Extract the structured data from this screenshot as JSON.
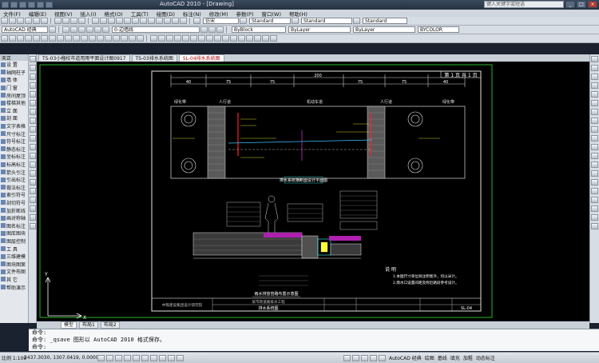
{
  "window": {
    "title": "AutoCAD 2010 - [Drawing]",
    "search_placeholder": "键入关键字或短语"
  },
  "menu": {
    "items": [
      "文件(F)",
      "编辑(E)",
      "视图(V)",
      "插入(I)",
      "格式(O)",
      "工具(T)",
      "绘图(D)",
      "标注(N)",
      "修改(M)",
      "参数(P)",
      "窗口(W)",
      "帮助(H)"
    ]
  },
  "toolbar": {
    "workspace": "AutoCAD 经典",
    "text_style": "Standard",
    "dim_style": "Standard",
    "table_style": "Standard",
    "font": "仿宋",
    "layer": "0-边墙线",
    "color": "ByBlock",
    "linetype": "ByLayer",
    "lineweight": "ByLayer",
    "plot_style": "BYCOLOR"
  },
  "left_panel": {
    "header": "天正",
    "items": [
      "设 置",
      "轴网柱子",
      "墙 体",
      "门 窗",
      "房间屋顶",
      "楼梯其他",
      "立 面",
      "剖 面",
      "文字表格",
      "尺寸标注",
      "符号标注",
      "静态标注",
      "坐标标注",
      "标高标注",
      "箭头引注",
      "引出标注",
      "做法标注",
      "索引符号",
      "剖切符号",
      "加折断线",
      "画对称轴",
      "图名标注",
      "图库图块",
      "图层控制",
      "工 具",
      "三维建模",
      "图块图案",
      "文件布图",
      "其 它",
      "帮助演示"
    ]
  },
  "doc_tabs": [
    "TS-03小榴校市道用雨平面设计图0917",
    "TS-03排水系统图",
    "SL-04排水系统图"
  ],
  "drawing": {
    "title": "排水系统图",
    "section_title": "排水系统横断面设计平面图",
    "detail_title": "雨水排放管路布置示意图",
    "total_width": "200",
    "segments": [
      "40",
      "75",
      "75",
      "75",
      "75",
      "40"
    ],
    "lane_labels": [
      "绿化带",
      "人行道",
      "机动车道",
      "人行道",
      "绿化带"
    ],
    "notes_title": "说 明",
    "notes": [
      "1.本图尺寸单位除注明者外，均以米计。",
      "2.雨水口设置间距及附近路段参考设计。",
      "3.施工时请严格按照相关规范施工。"
    ],
    "title_block": {
      "company": "中铁建设集团设计研究院",
      "project": "某市政道路排水工程",
      "drawing_name": "排水系统图",
      "sheet": "SL-04",
      "page": "第 1 页 共 1 页"
    }
  },
  "layout_tabs": [
    "模型",
    "布局1",
    "布局2"
  ],
  "command": {
    "line1": "命令:",
    "line2": "命令: _qsave 图形以 AutoCAD 2010 格式保存。",
    "prompt": "命令:"
  },
  "status": {
    "scale": "比例 1:100",
    "coords": "2437.3030, 1307.0419, 0.0000",
    "workspace_label": "AutoCAD 经典",
    "right_items": [
      "绘图",
      "基线",
      "填充",
      "加粗",
      "动态标注"
    ]
  }
}
